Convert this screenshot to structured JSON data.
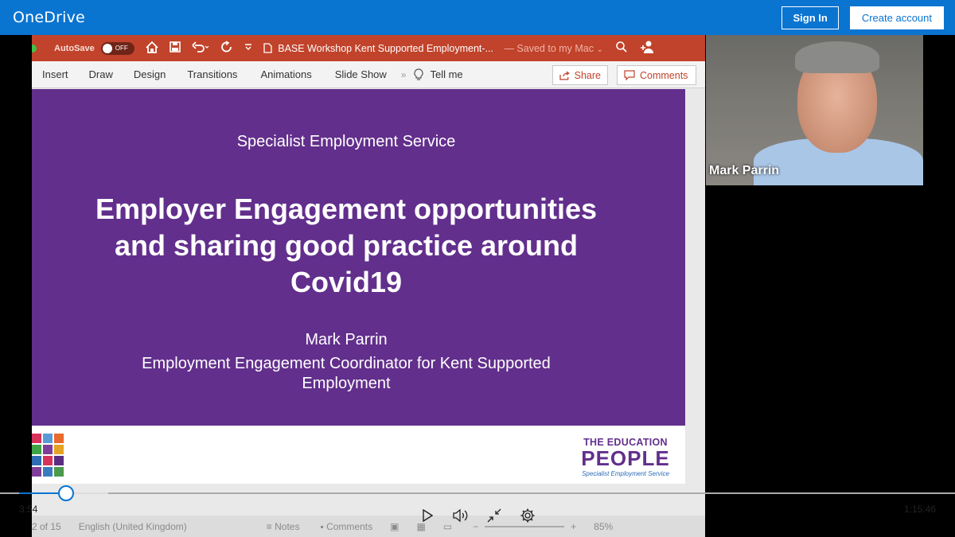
{
  "onedrive": {
    "brand": "OneDrive",
    "sign_in": "Sign In",
    "create_account": "Create account",
    "brand_color": "#0a74d1"
  },
  "powerpoint": {
    "autosave_label": "AutoSave",
    "autosave_state": "OFF",
    "document_title": "BASE Workshop Kent Supported Employment-...",
    "saved_status": "— Saved to my Mac",
    "ribbon_tabs": [
      "Insert",
      "Draw",
      "Design",
      "Transitions",
      "Animations",
      "Slide Show"
    ],
    "tell_me": "Tell me",
    "share": "Share",
    "comments": "Comments",
    "accent_color": "#c1432b",
    "status": {
      "slide_counter": "2 of 15",
      "language": "English (United Kingdom)",
      "notes": "Notes",
      "comments": "Comments",
      "zoom": "85%"
    }
  },
  "slide": {
    "subtitle": "Specialist Employment Service",
    "title_lines": [
      "Employer Engagement opportunities",
      "and sharing good practice around",
      "Covid19"
    ],
    "author": "Mark Parrin",
    "role": "Employment Engagement Coordinator for Kent Supported Employment",
    "background_color": "#622f8c",
    "logo": {
      "line1": "THE EDUCATION",
      "line2": "PEOPLE",
      "line3": "Specialist Employment Service"
    }
  },
  "webcam": {
    "participant_name": "Mark Parrin"
  },
  "player": {
    "current_time": "3:54",
    "duration": "1:15:46",
    "progress_fraction": 0.0515,
    "buffered_fraction": 0.0975
  }
}
